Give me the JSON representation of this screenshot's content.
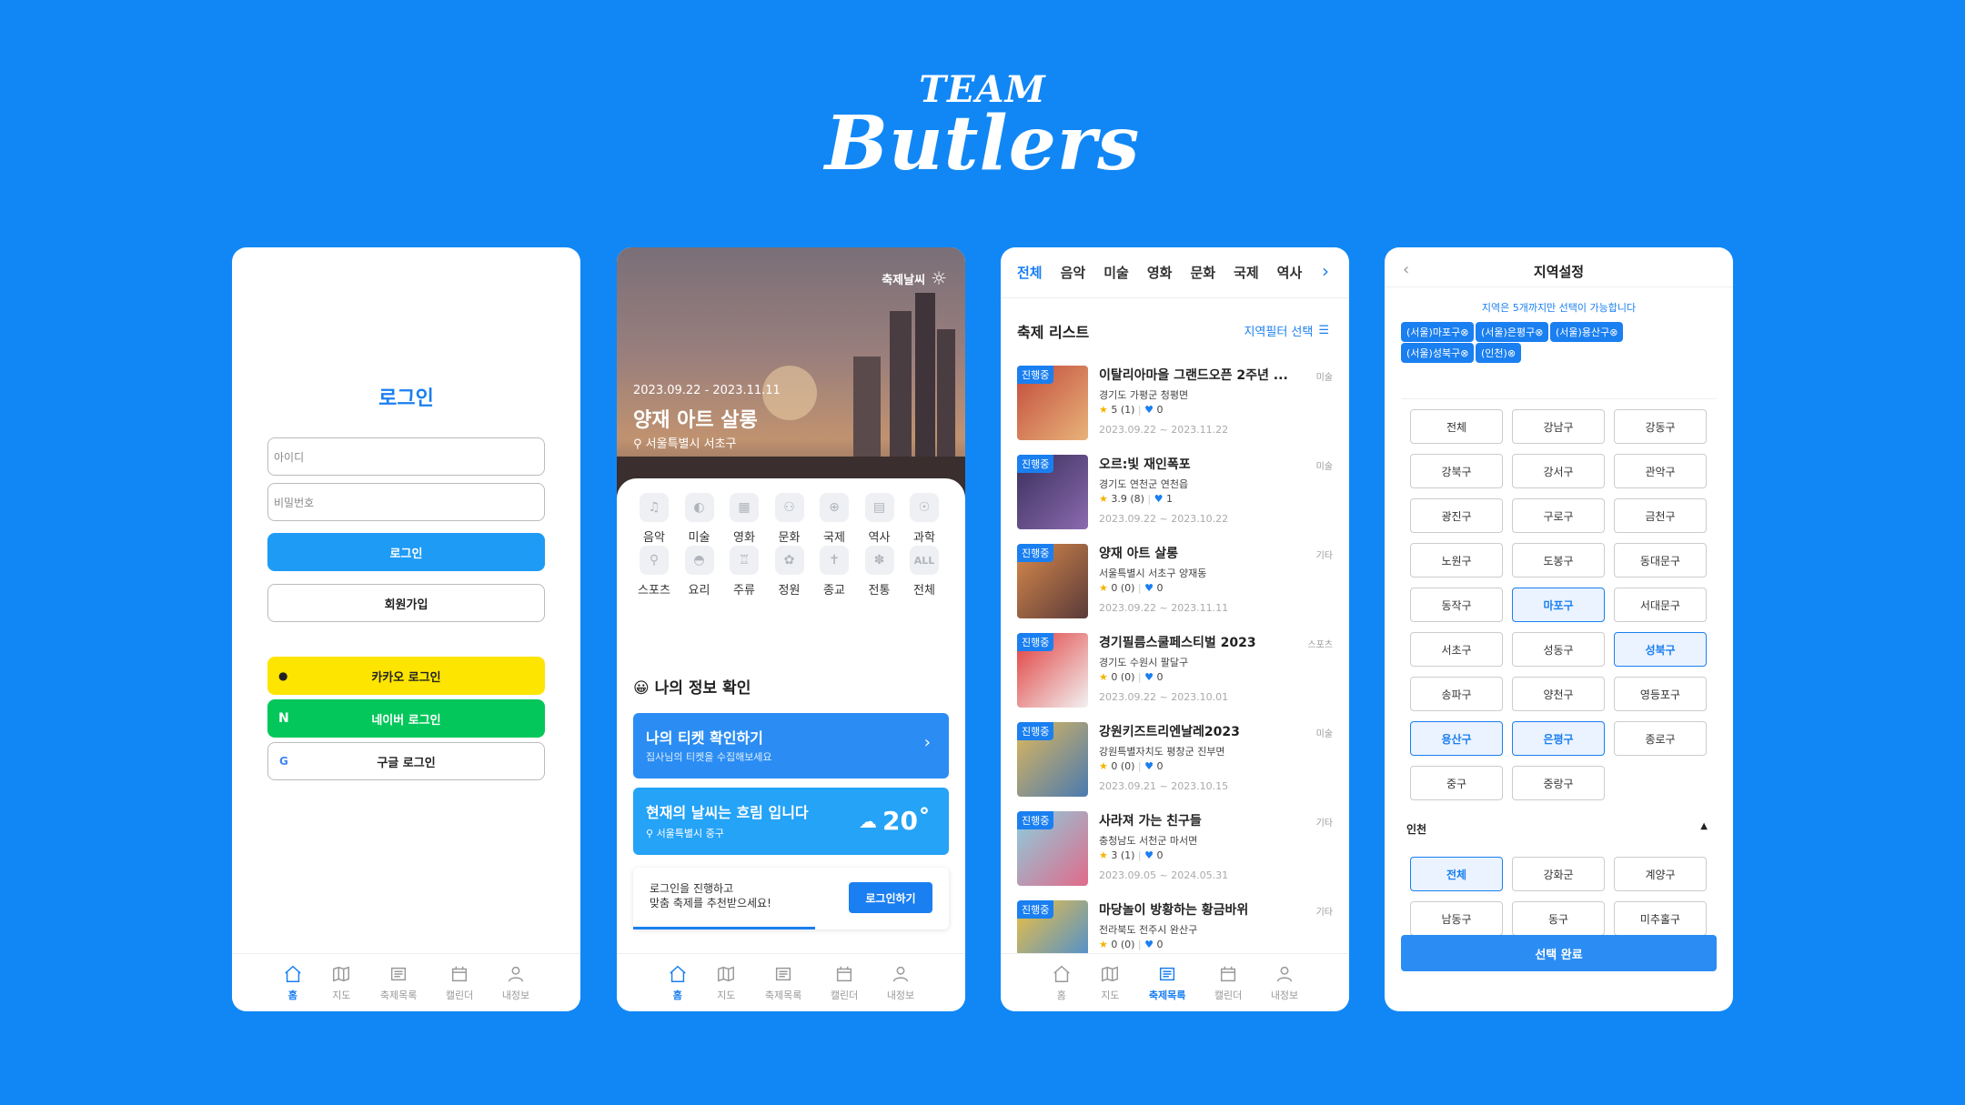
{
  "brand": {
    "team": "TEAM",
    "name": "Butlers"
  },
  "nav": [
    "홈",
    "지도",
    "축제목록",
    "캘린더",
    "내정보"
  ],
  "login": {
    "title": "로그인",
    "id_placeholder": "아이디",
    "pw_placeholder": "비밀번호",
    "login_button": "로그인",
    "signup_button": "회원가입",
    "kakao": "카카오 로그인",
    "naver": "네이버 로그인",
    "google": "구글 로그인"
  },
  "home": {
    "weather_link": "축제날씨",
    "event_dates": "2023.09.22 - 2023.11.11",
    "event_title": "양재 아트 살롱",
    "event_location": "서울특별시 서초구",
    "categories": [
      "음악",
      "미술",
      "영화",
      "문화",
      "국제",
      "역사",
      "과학",
      "스포츠",
      "요리",
      "주류",
      "정원",
      "종교",
      "전통",
      "전체"
    ],
    "all_icon_text": "ALL",
    "my_info_title": "나의 정보 확인",
    "ticket_title": "나의 티켓 확인하기",
    "ticket_sub": "집사님의 티켓을 수집해보세요",
    "weather_title": "현재의 날씨는 흐림 입니다",
    "weather_sub": "서울특별시 중구",
    "temperature": "20˚",
    "login_prompt_1": "로그인을 진행하고",
    "login_prompt_2": "맞춤 축제를 추천받으세요!",
    "login_prompt_button": "로그인하기",
    "accent": "#1a7ff0"
  },
  "list": {
    "tabs": [
      "전체",
      "음악",
      "미술",
      "영화",
      "문화",
      "국제",
      "역사"
    ],
    "section_title": "축제 리스트",
    "filter_label": "지역필터 선택",
    "badge": "진행중",
    "items": [
      {
        "title": "이탈리아마을 그랜드오픈 2주년 ...",
        "location": "경기도 가평군 청평면",
        "rating": "5 (1)",
        "likes": "0",
        "dates": "2023.09.22 ~ 2023.11.22",
        "category": "미술"
      },
      {
        "title": "오르:빛 재인폭포",
        "location": "경기도 연천군 연천읍",
        "rating": "3.9 (8)",
        "likes": "1",
        "dates": "2023.09.22 ~ 2023.10.22",
        "category": "미술"
      },
      {
        "title": "양재 아트 살롱",
        "location": "서울특별시 서초구 양재동",
        "rating": "0 (0)",
        "likes": "0",
        "dates": "2023.09.22 ~ 2023.11.11",
        "category": "기타"
      },
      {
        "title": "경기필름스쿨페스티벌 2023",
        "location": "경기도 수원시 팔달구",
        "rating": "0 (0)",
        "likes": "0",
        "dates": "2023.09.22 ~ 2023.10.01",
        "category": "스포츠"
      },
      {
        "title": "강원키즈트리엔날레2023",
        "location": "강원특별자치도 평창군 진부면",
        "rating": "0 (0)",
        "likes": "0",
        "dates": "2023.09.21 ~ 2023.10.15",
        "category": "미술"
      },
      {
        "title": "사라져 가는 친구들",
        "location": "충청남도 서천군 마서면",
        "rating": "3 (1)",
        "likes": "0",
        "dates": "2023.09.05 ~ 2024.05.31",
        "category": "기타"
      },
      {
        "title": "마당놀이 방황하는 황금바위",
        "location": "전라북도 전주시 완산구",
        "rating": "0 (0)",
        "likes": "0",
        "dates": "",
        "category": "기타"
      }
    ]
  },
  "region": {
    "title": "지역설정",
    "note": "지역은 5개까지만 선택이 가능합니다",
    "chips": [
      "(서울)마포구",
      "(서울)은평구",
      "(서울)용산구",
      "(서울)성북구",
      "(인천)"
    ],
    "seoul": [
      "전체",
      "강남구",
      "강동구",
      "강북구",
      "강서구",
      "관악구",
      "광진구",
      "구로구",
      "금천구",
      "노원구",
      "도봉구",
      "동대문구",
      "동작구",
      "마포구",
      "서대문구",
      "서초구",
      "성동구",
      "성북구",
      "송파구",
      "양천구",
      "영등포구",
      "용산구",
      "은평구",
      "종로구",
      "중구",
      "중랑구"
    ],
    "seoul_selected": [
      13,
      17,
      21,
      22
    ],
    "incheon_label": "인천",
    "incheon": [
      "전체",
      "강화군",
      "계양구",
      "남동구",
      "동구",
      "미추홀구"
    ],
    "incheon_selected": [
      0
    ],
    "done_button": "선택 완료"
  }
}
